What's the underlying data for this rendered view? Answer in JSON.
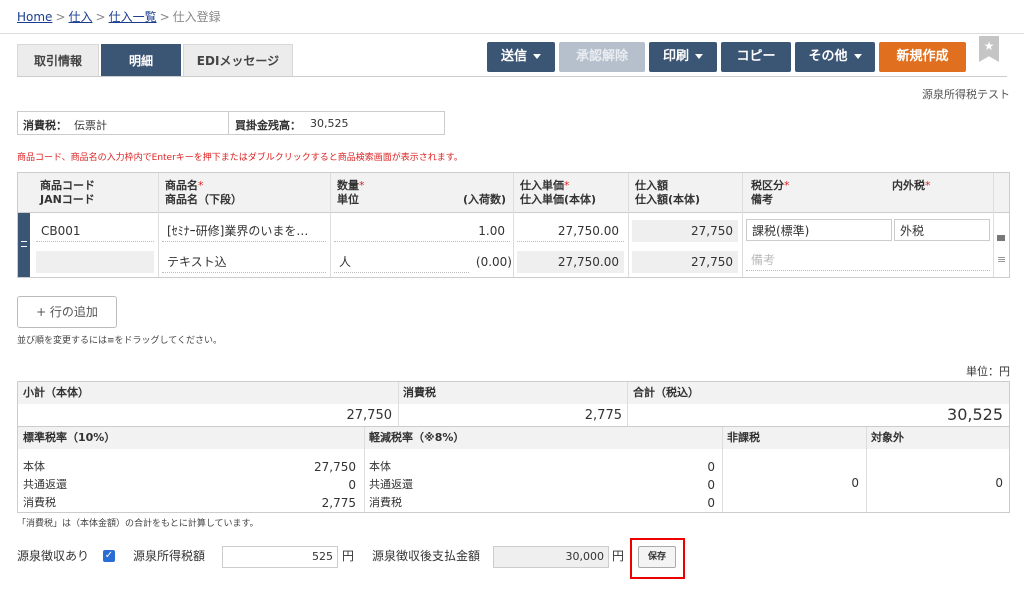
{
  "breadcrumb": {
    "home": "Home",
    "sep": ">",
    "purchase": "仕入",
    "purchase_list": "仕入一覧",
    "current": "仕入登録"
  },
  "tabs": [
    "取引情報",
    "明細",
    "EDIメッセージ"
  ],
  "toolbar": {
    "send": "送信",
    "unapprove": "承認解除",
    "print": "印刷",
    "copy": "コピー",
    "other": "その他",
    "new": "新規作成"
  },
  "subtitle": "源泉所得税テスト",
  "info": {
    "tax_label": "消費税：",
    "tax_value": "伝票計",
    "balance_label": "買掛金残高：",
    "balance_value": "30,525"
  },
  "note_red": "商品コード、商品名の入力枠内でEnterキーを押下またはダブルクリックすると商品検索画面が表示されます。",
  "grid": {
    "headers": {
      "code": "商品コード",
      "jan": "JANコード",
      "name": "商品名",
      "name2": "商品名（下段）",
      "qty": "数量",
      "unit": "単位",
      "in_count": "(入荷数)",
      "price": "仕入単価",
      "price_net": "仕入単価(本体)",
      "amount": "仕入額",
      "amount_net": "仕入額(本体)",
      "tax_class": "税区分",
      "remarks": "備考",
      "tax_type": "内外税",
      "req": "*"
    },
    "row": {
      "code": "CB001",
      "name": "[ｾﾐﾅｰ研修]業界のいまを…",
      "qty": "1.00",
      "price": "27,750.00",
      "amount": "27,750",
      "tax_class": "課税(標準)",
      "tax_type": "外税",
      "name2": "テキスト込",
      "unit": "人",
      "in_count": "(0.00)",
      "price_net": "27,750.00",
      "amount_net": "27,750",
      "remarks_placeholder": "備考"
    }
  },
  "add_row": "+ 行の追加",
  "drag_note": "並び順を変更するには≡をドラッグしてください。",
  "unit_label": "単位：円",
  "summary": {
    "subtotal_label": "小計（本体）",
    "tax_label": "消費税",
    "total_label": "合計（税込）",
    "subtotal": "27,750",
    "tax": "2,775",
    "total": "30,525",
    "std_label": "標準税率（10%）",
    "reduced_label": "軽減税率（※8%）",
    "nontax_label": "非課税",
    "exempt_label": "対象外",
    "body": "本体",
    "refund": "共通返還",
    "ctax": "消費税",
    "std_body": "27,750",
    "std_refund": "0",
    "std_tax": "2,775",
    "red_body": "0",
    "red_refund": "0",
    "red_tax": "0",
    "nontax": "0",
    "exempt": "0"
  },
  "footnote": "「消費税」は（本体金額）の合計をもとに計算しています。",
  "withholding": {
    "label": "源泉徴収あり",
    "amount_label": "源泉所得税額",
    "amount": "525",
    "yen": "円",
    "after_label": "源泉徴収後支払金額",
    "after": "30,000",
    "save": "保存"
  }
}
